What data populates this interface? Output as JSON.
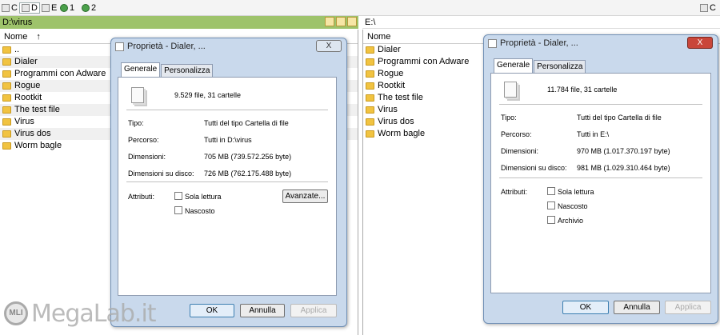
{
  "drives": [
    {
      "label": "C",
      "selected": false
    },
    {
      "label": "D",
      "selected": true
    },
    {
      "label": "E",
      "selected": false
    },
    {
      "label": "1",
      "selected": false
    },
    {
      "label": "2",
      "selected": false
    }
  ],
  "right_drive": {
    "label": "C"
  },
  "left_path": "D:\\virus",
  "right_path": "E:\\",
  "left_pane": {
    "column": "Nome",
    "sort_arrow": "↑",
    "rows": [
      "..",
      "Dialer",
      "Programmi con Adware",
      "Rogue",
      "Rootkit",
      "The test file",
      "Virus",
      "Virus dos",
      "Worm bagle"
    ]
  },
  "right_pane": {
    "column": "Nome",
    "rows": [
      "Dialer",
      "Programmi con Adware",
      "Rogue",
      "Rootkit",
      "The test file",
      "Virus",
      "Virus dos",
      "Worm bagle"
    ]
  },
  "dialog_left": {
    "title": "Proprietà - Dialer, ...",
    "close": "X",
    "tabs": [
      "Generale",
      "Personalizza"
    ],
    "summary": "9.529 file, 31 cartelle",
    "rows": [
      {
        "label": "Tipo:",
        "value": "Tutti del tipo Cartella di file"
      },
      {
        "label": "Percorso:",
        "value": "Tutti in D:\\virus"
      },
      {
        "label": "Dimensioni:",
        "value": "705 MB (739.572.256 byte)"
      },
      {
        "label": "Dimensioni su disco:",
        "value": "726 MB (762.175.488 byte)"
      }
    ],
    "attributes_label": "Attributi:",
    "attributes": [
      "Sola lettura",
      "Nascosto"
    ],
    "advanced_button": "Avanzate...",
    "buttons": [
      "OK",
      "Annulla",
      "Applica"
    ]
  },
  "dialog_right": {
    "title": "Proprietà - Dialer, ...",
    "close": "X",
    "tabs": [
      "Generale",
      "Personalizza"
    ],
    "summary": "11.784 file, 31 cartelle",
    "rows": [
      {
        "label": "Tipo:",
        "value": "Tutti del tipo Cartella di file"
      },
      {
        "label": "Percorso:",
        "value": "Tutti in E:\\"
      },
      {
        "label": "Dimensioni:",
        "value": "970 MB (1.017.370.197 byte)"
      },
      {
        "label": "Dimensioni su disco:",
        "value": "981 MB (1.029.310.464 byte)"
      }
    ],
    "attributes_label": "Attributi:",
    "attributes": [
      "Sola lettura",
      "Nascosto",
      "Archivio"
    ],
    "buttons": [
      "OK",
      "Annulla",
      "Applica"
    ]
  },
  "watermark": {
    "badge": "MLI",
    "text": "MegaLab.it"
  }
}
